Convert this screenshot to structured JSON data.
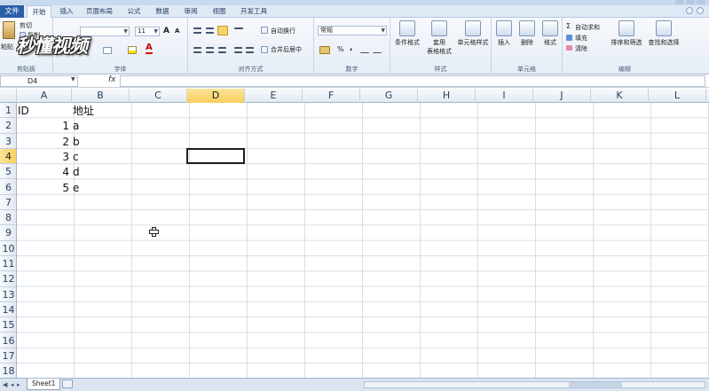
{
  "window": {
    "title": ""
  },
  "ribbon_tabs": [
    {
      "label": "文件"
    },
    {
      "label": "开始"
    },
    {
      "label": "插入"
    },
    {
      "label": "页面布局"
    },
    {
      "label": "公式"
    },
    {
      "label": "数据"
    },
    {
      "label": "审阅"
    },
    {
      "label": "视图"
    },
    {
      "label": "开发工具"
    }
  ],
  "clipboard": {
    "paste": "粘贴",
    "cut": "剪切",
    "copy": "复制",
    "format_painter": "格式刷",
    "group": "剪贴板"
  },
  "font": {
    "name": "",
    "size": "11",
    "grow": "A",
    "shrink": "A",
    "bold": "B",
    "italic": "I",
    "underline": "U",
    "color_glyph": "A",
    "group": "字体"
  },
  "alignment": {
    "wrap_text": "自动换行",
    "merge_center": "合并后居中",
    "group": "对齐方式"
  },
  "number": {
    "format": "常规",
    "percent": "%",
    "comma": ",",
    "group": "数字"
  },
  "styles": {
    "conditional": "条件格式",
    "table_format_line1": "套用",
    "table_format_line2": "表格格式",
    "cell_styles": "单元格样式",
    "group": "样式"
  },
  "cells_group": {
    "insert": "插入",
    "delete": "删除",
    "format": "格式",
    "group": "单元格"
  },
  "editing": {
    "autosum": "自动求和",
    "fill": "填充",
    "clear": "清除",
    "sort_filter": "排序和筛选",
    "find_select": "查找和选择",
    "group": "编辑"
  },
  "watermark": {
    "logo_text": "秒懂视频"
  },
  "formula_bar": {
    "name_box": "D4",
    "fx": "fx",
    "formula": ""
  },
  "columns": [
    "A",
    "B",
    "C",
    "D",
    "E",
    "F",
    "G",
    "H",
    "I",
    "J",
    "K",
    "L"
  ],
  "selected_column": "D",
  "rows": [
    "1",
    "2",
    "3",
    "4",
    "5",
    "6",
    "7",
    "8",
    "9",
    "10",
    "11",
    "12",
    "13",
    "14",
    "15",
    "16",
    "17",
    "18"
  ],
  "selected_row": "4",
  "sheet": {
    "A1": "ID",
    "B1": "地址",
    "A2": "1",
    "B2": "a",
    "A3": "2",
    "B3": "b",
    "A4": "3",
    "B4": "c",
    "A5": "4",
    "B5": "d",
    "A6": "5",
    "B6": "e"
  },
  "sheet_tabs": [
    {
      "label": "Sheet1"
    }
  ],
  "colors": {
    "file_tab": "#2a5fa8",
    "selected_header": "#f8cf5b",
    "grid_line": "#d9dee6"
  }
}
